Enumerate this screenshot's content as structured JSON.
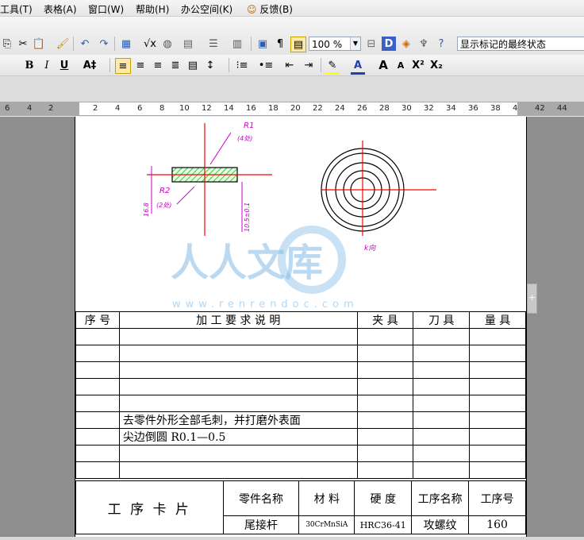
{
  "menubar": {
    "items": [
      {
        "label": "工具(T)",
        "underline_key": "T"
      },
      {
        "label": "表格(A)"
      },
      {
        "label": "窗口(W)"
      },
      {
        "label": "帮助(H)"
      },
      {
        "label": "办公空间(K)"
      },
      {
        "label": "反馈(B)"
      }
    ]
  },
  "toolbar": {
    "zoom": "100 %",
    "markup_state": "显示标记的最终状态",
    "bold": "B",
    "italic": "I",
    "underline": "U",
    "font_color": "A",
    "grow_font": "A",
    "shrink_font": "A",
    "superscript": "X²",
    "subscript": "X₂"
  },
  "ruler": {
    "ticks": [
      "6",
      "4",
      "2",
      "2",
      "4",
      "6",
      "8",
      "10",
      "12",
      "14",
      "16",
      "18",
      "20",
      "22",
      "24",
      "26",
      "28",
      "30",
      "32",
      "34",
      "36",
      "38",
      "4",
      "42",
      "44"
    ]
  },
  "drawing": {
    "label_r1": "R1",
    "label_r1_sub": "(4处)",
    "label_r2": "R2",
    "label_r2_sub": "(2处)",
    "dim_left": "16.8",
    "dim_right": "10.5±0.1",
    "label_k": "k向"
  },
  "watermark": {
    "text": "人人文库",
    "url": "www.renrendoc.com"
  },
  "process_table": {
    "headers": [
      "序 号",
      "加   工   要   求   说   明",
      "夹   具",
      "刀   具",
      "量   具"
    ],
    "rows": [
      [
        "",
        "",
        "",
        "",
        ""
      ],
      [
        "",
        "",
        "",
        "",
        ""
      ],
      [
        "",
        "",
        "",
        "",
        ""
      ],
      [
        "",
        "",
        "",
        "",
        ""
      ],
      [
        "",
        "",
        "",
        "",
        ""
      ],
      [
        "",
        "去零件外形全部毛刺，并打磨外表面",
        "",
        "",
        ""
      ],
      [
        "",
        "尖边倒圆 R0.1—0.5",
        "",
        "",
        ""
      ],
      [
        "",
        "",
        "",
        "",
        ""
      ],
      [
        "",
        "",
        "",
        "",
        ""
      ]
    ]
  },
  "footer_table": {
    "title": "工 序 卡 片",
    "headers": [
      "零件名称",
      "材  料",
      "硬  度",
      "工序名称",
      "工序号"
    ],
    "values": [
      "尾接杆",
      "30CrMnSiA",
      "HRC36-41",
      "攻螺纹",
      "160"
    ]
  },
  "colors": {
    "hatch": "#33cc33",
    "centerline": "#ff0000",
    "annotation": "#cc00cc",
    "watermark": "#5aa7e0"
  }
}
